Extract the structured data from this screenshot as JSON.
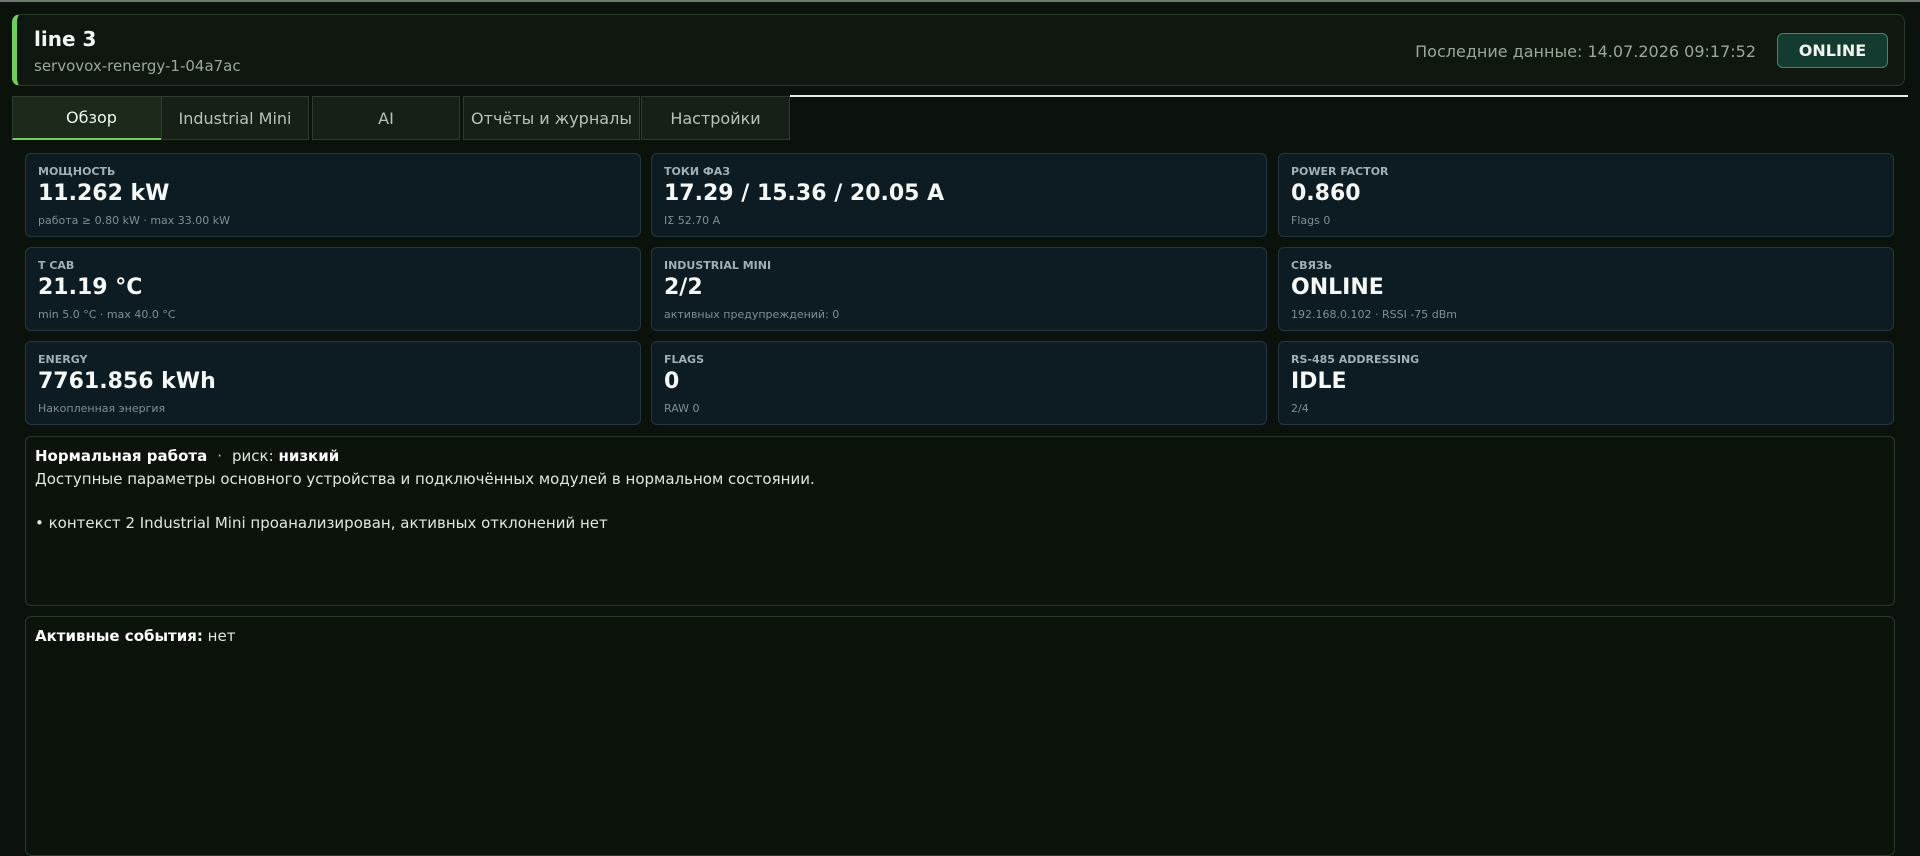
{
  "header": {
    "title": "line 3",
    "subtitle": "servovox-renergy-1-04a7ac",
    "last_data_label": "Последние данные:",
    "last_data_value": "14.07.2026 09:17:52",
    "status": "ONLINE"
  },
  "tabs": [
    {
      "label": "Обзор",
      "active": true
    },
    {
      "label": "Industrial Mini"
    },
    {
      "label": "AI"
    },
    {
      "label": "Отчёты и журналы"
    },
    {
      "label": "Настройки"
    }
  ],
  "cards": [
    {
      "label": "Мощность",
      "value": "11.262 kW",
      "sub": "работа ≥ 0.80 kW · max 33.00 kW"
    },
    {
      "label": "Токи фаз",
      "value": "17.29 / 15.36 / 20.05 A",
      "sub": "IΣ 52.70 A"
    },
    {
      "label": "Power factor",
      "value": "0.860",
      "sub": "Flags 0"
    },
    {
      "label": "T cab",
      "value": "21.19 °C",
      "sub": "min 5.0 °C · max 40.0 °C"
    },
    {
      "label": "Industrial Mini",
      "value": "2/2",
      "sub": "активных предупреждений: 0"
    },
    {
      "label": "Связь",
      "value": "ONLINE",
      "sub": "192.168.0.102 · RSSI -75 dBm"
    },
    {
      "label": "Energy",
      "value": "7761.856 kWh",
      "sub": "Накопленная энергия"
    },
    {
      "label": "Flags",
      "value": "0",
      "sub": "RAW 0"
    },
    {
      "label": "RS-485 addressing",
      "value": "IDLE",
      "sub": "2/4"
    }
  ],
  "status_panel": {
    "title": "Нормальная работа",
    "separator": "·",
    "risk_label": "риск:",
    "risk_value": "низкий",
    "description": "Доступные параметры основного устройства и подключённых модулей в нормальном состоянии.",
    "bullet": "• контекст 2 Industrial Mini проанализирован, активных отклонений нет"
  },
  "events_panel": {
    "label": "Активные события:",
    "value": "нет"
  },
  "colors": {
    "accent": "#6ecf5a",
    "background": "#0b110b",
    "card_background": "#0d1b22",
    "status_pill": "#143b2f"
  }
}
